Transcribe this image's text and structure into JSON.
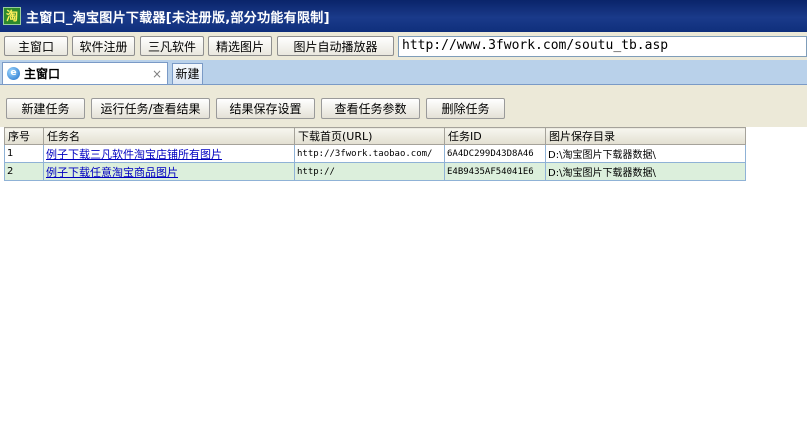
{
  "window": {
    "title": "主窗口_淘宝图片下载器[未注册版,部分功能有限制]",
    "icon": "淘"
  },
  "toolbar": {
    "buttons": [
      "主窗口",
      "软件注册",
      "三凡软件",
      "精选图片",
      "图片自动播放器"
    ],
    "url": "http://www.3fwork.com/soutu_tb.asp"
  },
  "tabs": {
    "active_label": "主窗口",
    "close_glyph": "×",
    "new_label": "新建"
  },
  "actions": [
    "新建任务",
    "运行任务/查看结果",
    "结果保存设置",
    "查看任务参数",
    "删除任务"
  ],
  "table": {
    "columns": [
      "序号",
      "任务名",
      "下载首页(URL)",
      "任务ID",
      "图片保存目录"
    ],
    "rows": [
      [
        "1",
        "例子下载三凡软件淘宝店铺所有图片",
        "http://3fwork.taobao.com/",
        "6A4DC299D43D8A46",
        "D:\\淘宝图片下载器数据\\"
      ],
      [
        "2",
        "例子下载任意淘宝商品图片",
        "http://",
        "E4B9435AF54041E6",
        "D:\\淘宝图片下载器数据\\"
      ]
    ]
  }
}
